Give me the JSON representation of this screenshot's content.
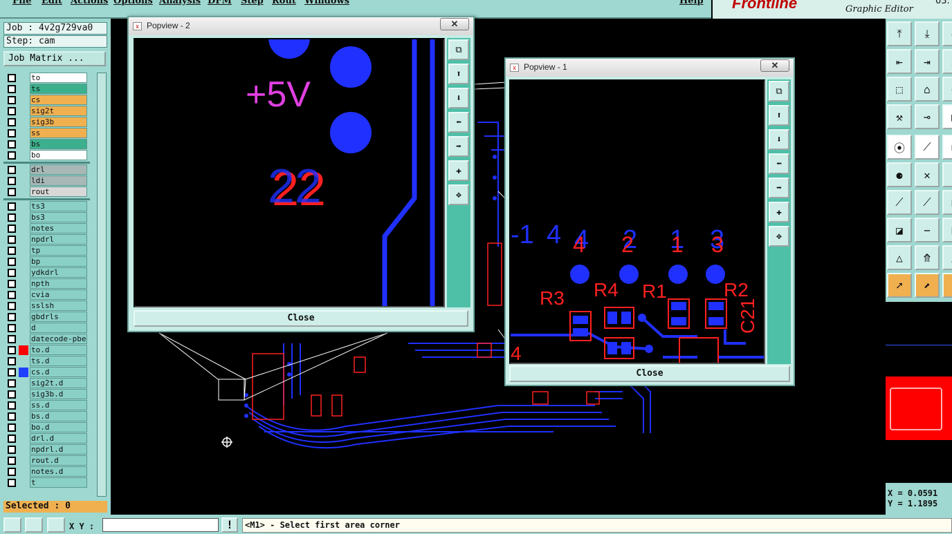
{
  "menu": {
    "items": [
      "File",
      "Edit",
      "Actions",
      "Options",
      "Analysis",
      "DFM",
      "Step",
      "Rout",
      "Windows"
    ],
    "help": "Help"
  },
  "brand": {
    "logo": "Frontline",
    "subtitle": "Graphic Editor",
    "version": "03."
  },
  "job": {
    "label": "Job : 4v2g729va0",
    "step": "Step: cam",
    "matrix_button": "Job Matrix ..."
  },
  "layers": [
    {
      "name": "to",
      "color": "#ffffff"
    },
    {
      "name": "ts",
      "color": "#3cb08c"
    },
    {
      "name": "cs",
      "color": "#f0b050"
    },
    {
      "name": "sig2t",
      "color": "#f0b050"
    },
    {
      "name": "sig3b",
      "color": "#f0b050"
    },
    {
      "name": "ss",
      "color": "#f0b050"
    },
    {
      "name": "bs",
      "color": "#3cb08c"
    },
    {
      "name": "bo",
      "color": "#ffffff"
    },
    {
      "name": "drl",
      "color": "#a8b8b6"
    },
    {
      "name": "ldi",
      "color": "#a8b8b6"
    },
    {
      "name": "rout",
      "color": "#d8d8d8"
    },
    {
      "name": "ts3"
    },
    {
      "name": "bs3"
    },
    {
      "name": "notes"
    },
    {
      "name": "npdrl"
    },
    {
      "name": "tp"
    },
    {
      "name": "bp"
    },
    {
      "name": "ydkdrl"
    },
    {
      "name": "npth"
    },
    {
      "name": "cvia"
    },
    {
      "name": "sslsh"
    },
    {
      "name": "gbdrls"
    },
    {
      "name": "d"
    },
    {
      "name": "datecode-pbe"
    },
    {
      "name": "to.d",
      "swatch": "#ff0000"
    },
    {
      "name": "ts.d"
    },
    {
      "name": "cs.d",
      "swatch": "#2040ff"
    },
    {
      "name": "sig2t.d"
    },
    {
      "name": "sig3b.d"
    },
    {
      "name": "ss.d"
    },
    {
      "name": "bs.d"
    },
    {
      "name": "bo.d"
    },
    {
      "name": "drl.d"
    },
    {
      "name": "npdrl.d"
    },
    {
      "name": "rout.d"
    },
    {
      "name": "notes.d"
    },
    {
      "name": "t"
    }
  ],
  "selected": "Selected : 0",
  "status": {
    "xy_label": "X Y :",
    "xy_value": "",
    "prompt": "<M1> - Select first area corner"
  },
  "coords": {
    "x": "X = 0.0591",
    "y": "Y = 1.1895"
  },
  "popview2": {
    "title": "Popview - 2",
    "close": "Close",
    "labels": [
      "+5V",
      "22"
    ]
  },
  "popview1": {
    "title": "Popview - 1",
    "close": "Close",
    "blue_labels": [
      "-1",
      "4",
      "4",
      "2",
      "1",
      "3"
    ],
    "red_labels": [
      "4",
      "2",
      "1",
      "3",
      "R3",
      "R4",
      "R1",
      "R2",
      "C21"
    ],
    "bottom_label": "4"
  },
  "colors": {
    "panel": "#9ed8d0",
    "accent": "#f0b050",
    "trace_blue": "#2030ff",
    "trace_red": "#ff2020",
    "magenta": "#e040e0"
  },
  "icons": {
    "close": "x-icon",
    "zoom": "zoom-icon",
    "pan": "pan-icon"
  }
}
